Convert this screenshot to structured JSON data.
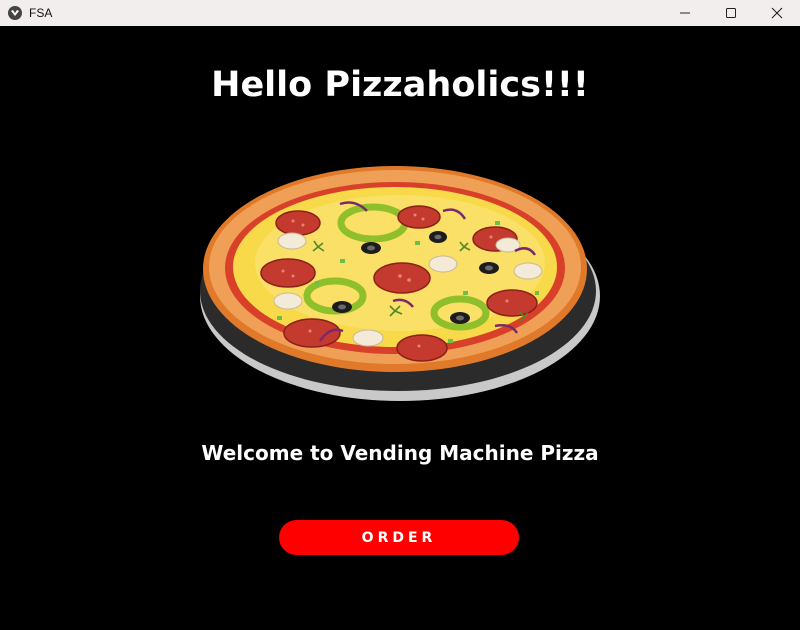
{
  "window": {
    "title": "FSA"
  },
  "main": {
    "heading": "Hello Pizzaholics!!!",
    "welcome": "Welcome to Vending Machine Pizza",
    "order_label": "ORDER"
  },
  "colors": {
    "background": "#000000",
    "accent": "#ff0000",
    "text": "#ffffff",
    "titlebar": "#f3eeee"
  },
  "icons": [
    "app-icon",
    "minimize-icon",
    "maximize-icon",
    "close-icon",
    "pizza-illustration"
  ]
}
